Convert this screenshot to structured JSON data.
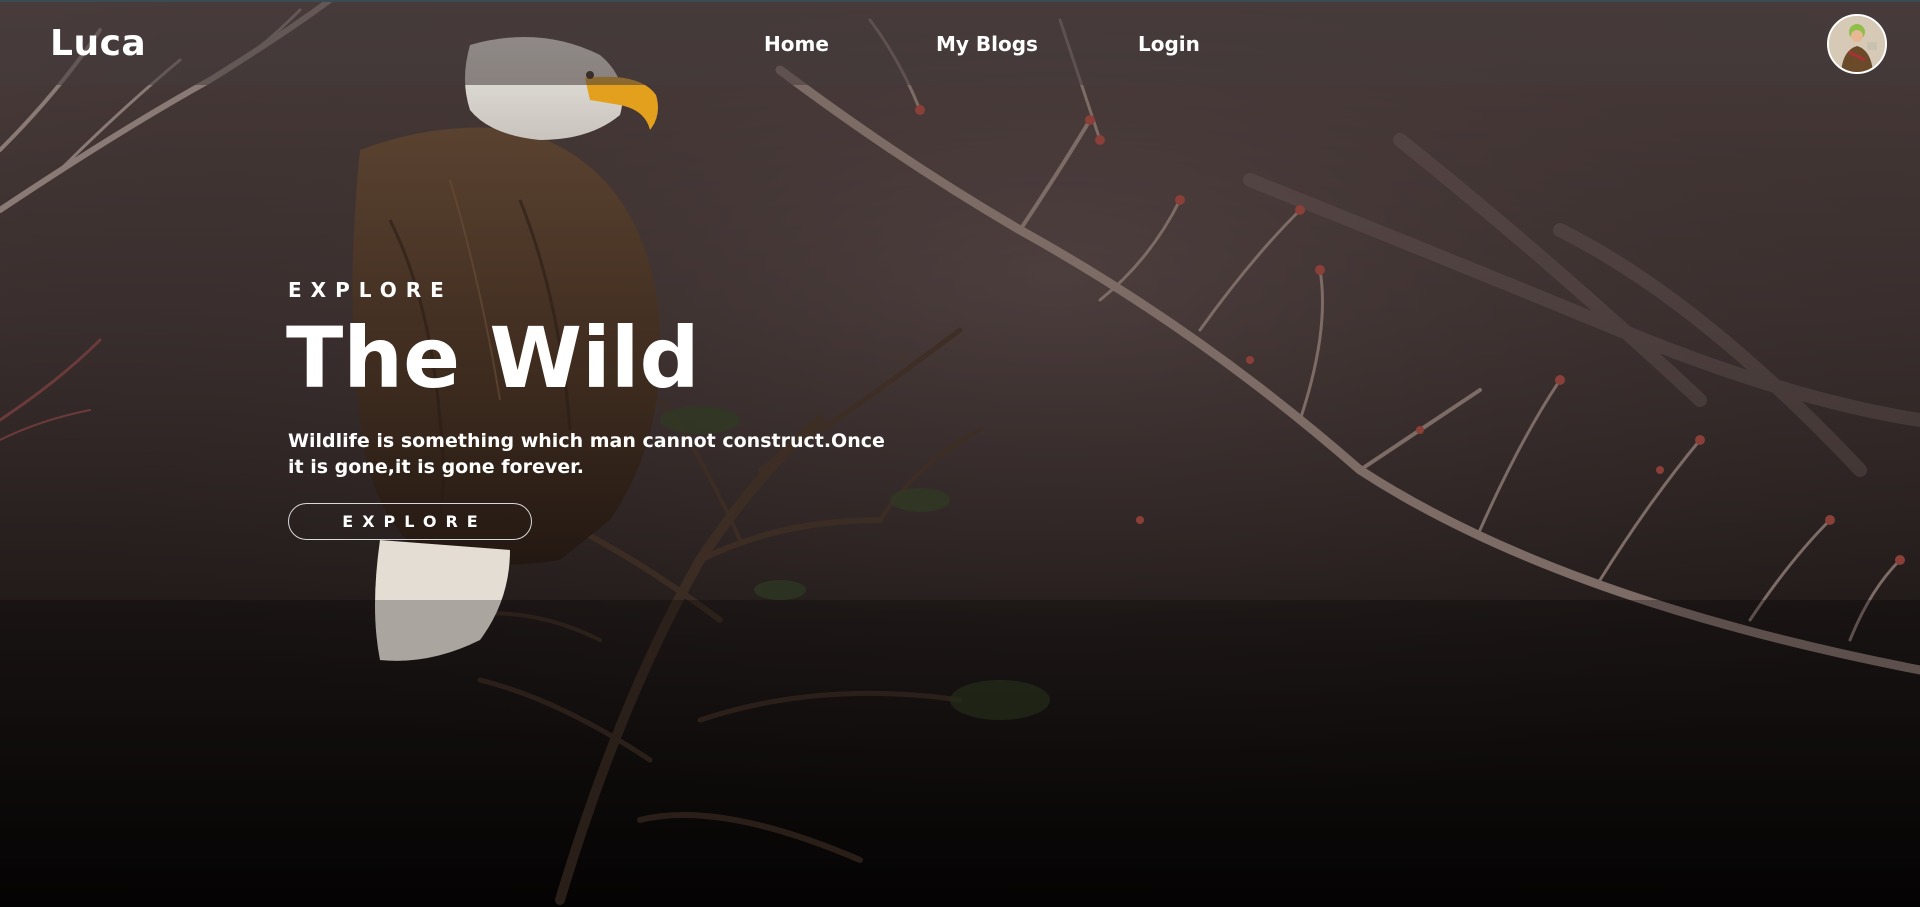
{
  "app": {
    "logo": "Luca"
  },
  "nav": {
    "links": [
      {
        "label": "Home"
      },
      {
        "label": "My Blogs"
      },
      {
        "label": "Login"
      }
    ]
  },
  "hero": {
    "eyebrow": "EXPLORE",
    "title": "The Wild",
    "description": "Wildlife is something which man cannot construct.Once it is gone,it is gone forever.",
    "button_label": "EXPLORE"
  },
  "icons": {
    "avatar": "user-avatar-icon",
    "background": "bald-eagle-on-branch-photo"
  },
  "colors": {
    "text": "#ffffff",
    "navbar": "#463c3c",
    "background_dark": "#0c0908",
    "background_mid": "#3d3231"
  }
}
